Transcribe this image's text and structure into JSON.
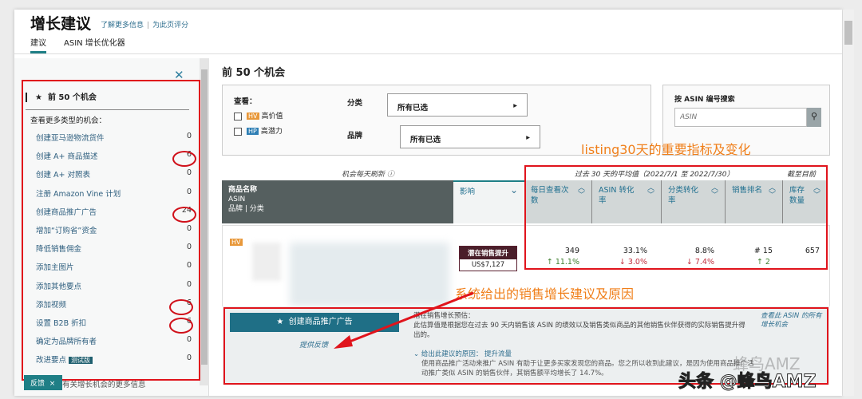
{
  "header": {
    "title": "增长建议",
    "learn_more": "了解更多信息",
    "rate_page": "为此页评分",
    "tabs": [
      "建议",
      "ASIN 增长优化器"
    ]
  },
  "sidebar": {
    "heading": "前 50 个机会",
    "subheading": "查看更多类型的机会：",
    "items": [
      {
        "label": "创建亚马逊物流货件",
        "count": "0"
      },
      {
        "label": "创建 A+ 商品描述",
        "count": "6"
      },
      {
        "label": "创建 A+ 对照表",
        "count": "0"
      },
      {
        "label": "注册 Amazon Vine 计划",
        "count": "0"
      },
      {
        "label": "创建商品推广广告",
        "count": "24"
      },
      {
        "label": "增加“订购省”资金",
        "count": "0"
      },
      {
        "label": "降低销售佣金",
        "count": "0"
      },
      {
        "label": "添加主图片",
        "count": "0"
      },
      {
        "label": "添加其他要点",
        "count": "0"
      },
      {
        "label": "添加视频",
        "count": "6"
      },
      {
        "label": "设置 B2B 折扣",
        "count": "6"
      },
      {
        "label": "确定为品牌所有者",
        "count": "0"
      },
      {
        "label": "改进要点",
        "count": "0",
        "badge": "测试版"
      }
    ],
    "feedback": "反馈",
    "feedback_close": "×",
    "more_info": "有关增长机会的更多信息"
  },
  "main": {
    "title": "前 50 个机会",
    "filters": {
      "view_label": "查看：",
      "hv_badge": "HV",
      "hv_label": "高价值",
      "hp_badge": "HP",
      "hp_label": "高潜力",
      "category_label": "分类",
      "category_value": "所有已选",
      "brand_label": "品牌",
      "brand_value": "所有已选"
    },
    "search": {
      "label": "按 ASIN 编号搜索",
      "placeholder": "ASIN"
    },
    "refresh_note": "机会每天刷新",
    "period_label": "过去 30 天的平均值（2022/7/1 至 2022/7/30）",
    "current_label": "截至目前",
    "columns": {
      "product": "商品名称",
      "asin": "ASIN",
      "brand_cat": "品牌 | 分类",
      "impact": "影响",
      "views": "每日查看次数",
      "asin_cvr": "ASIN 转化率",
      "cat_cvr": "分类转化率",
      "rank": "销售排名",
      "inventory": "库存数量"
    },
    "row": {
      "badge": "HV",
      "impact_label": "潜在销售提升",
      "impact_value": "US$7,127",
      "views": "349",
      "views_change": "11.1%",
      "asin_cvr": "33.1%",
      "asin_cvr_change": "3.0%",
      "cat_cvr": "8.8%",
      "cat_cvr_change": "7.4%",
      "rank": "# 15",
      "rank_change": "2",
      "inventory": "657"
    },
    "suggestion": {
      "button": "创建商品推广广告",
      "feedback": "提供反馈",
      "estimate_title": "潜在销售增长预估：",
      "estimate_text": "此估算值是根据您在过去 90 天内销售该 ASIN 的绩效以及销售类似商品的其他销售伙伴获得的实际销售提升得出的。",
      "reason_label": "给出此建议的原因：",
      "reason_value": "提升流量",
      "reason_text": "使用商品推广活动来推广 ASIN 有助于让更多买家发现您的商品。您之所以收到此建议，是因为使用商品推广活动推广类似 ASIN 的销售伙伴，其销售额平均增长了 14.7%。",
      "view_all": "查看此 ASIN 的所有增长机会"
    }
  },
  "annotations": {
    "metrics": "listing30天的重要指标及变化",
    "suggestion": "系统给出的销售增长建议及原因",
    "watermark": "头条 @蜂鸟AMZ",
    "watermark2": "蜂鸟AMZ"
  },
  "colors": {
    "accent": "#1f6f86",
    "annotation": "#f07f1a",
    "highlight": "#e0141c"
  }
}
